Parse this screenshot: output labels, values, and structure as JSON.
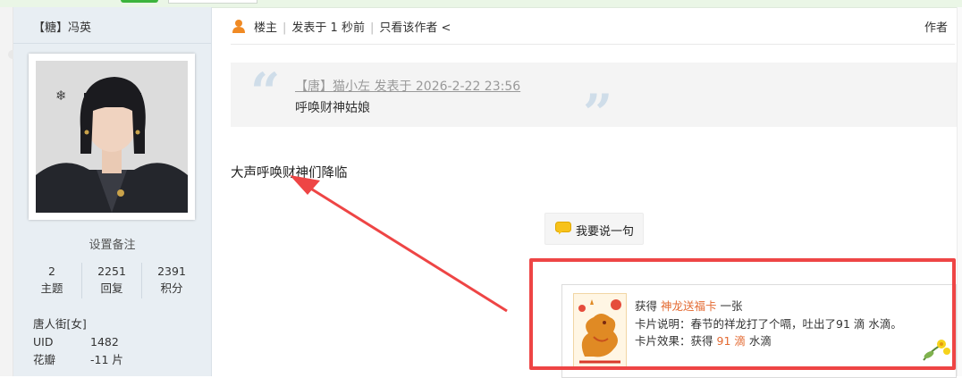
{
  "sidebar": {
    "author_name": "【糖】冯英",
    "set_note": "设置备注",
    "stats": [
      {
        "value": "2",
        "label": "主题"
      },
      {
        "value": "2251",
        "label": "回复"
      },
      {
        "value": "2391",
        "label": "积分"
      }
    ],
    "group": "唐人街[女]",
    "uid_label": "UID",
    "uid_value": "1482",
    "petal_label": "花瓣",
    "petal_value": "-11 片"
  },
  "post_header": {
    "role": "楼主",
    "posted": "发表于 1 秒前",
    "only_author": "只看该作者 <",
    "author_label": "作者"
  },
  "quote": {
    "meta": "【唐】猫小左 发表于 2026-2-22 23:56",
    "text": "呼唤财神姑娘"
  },
  "post_body": "大声呼唤财神们降临",
  "say_button": "我要说一句",
  "card": {
    "obtain_prefix": "获得",
    "card_name": "神龙送福卡",
    "obtain_suffix": "一张",
    "desc": "卡片说明：春节的祥龙打了个嗝，吐出了91 滴 水滴。",
    "effect_prefix": "卡片效果：获得",
    "effect_amount": "91 滴",
    "effect_suffix": "水滴"
  },
  "colors": {
    "accent_orange": "#e36a32",
    "annotation_red": "#ee4545",
    "sidebar_bg": "#e8eef3"
  },
  "icons": {
    "person": "person-icon",
    "bubble": "speech-bubble-icon",
    "quote_open": "quote-open-icon",
    "quote_close": "quote-close-icon"
  }
}
